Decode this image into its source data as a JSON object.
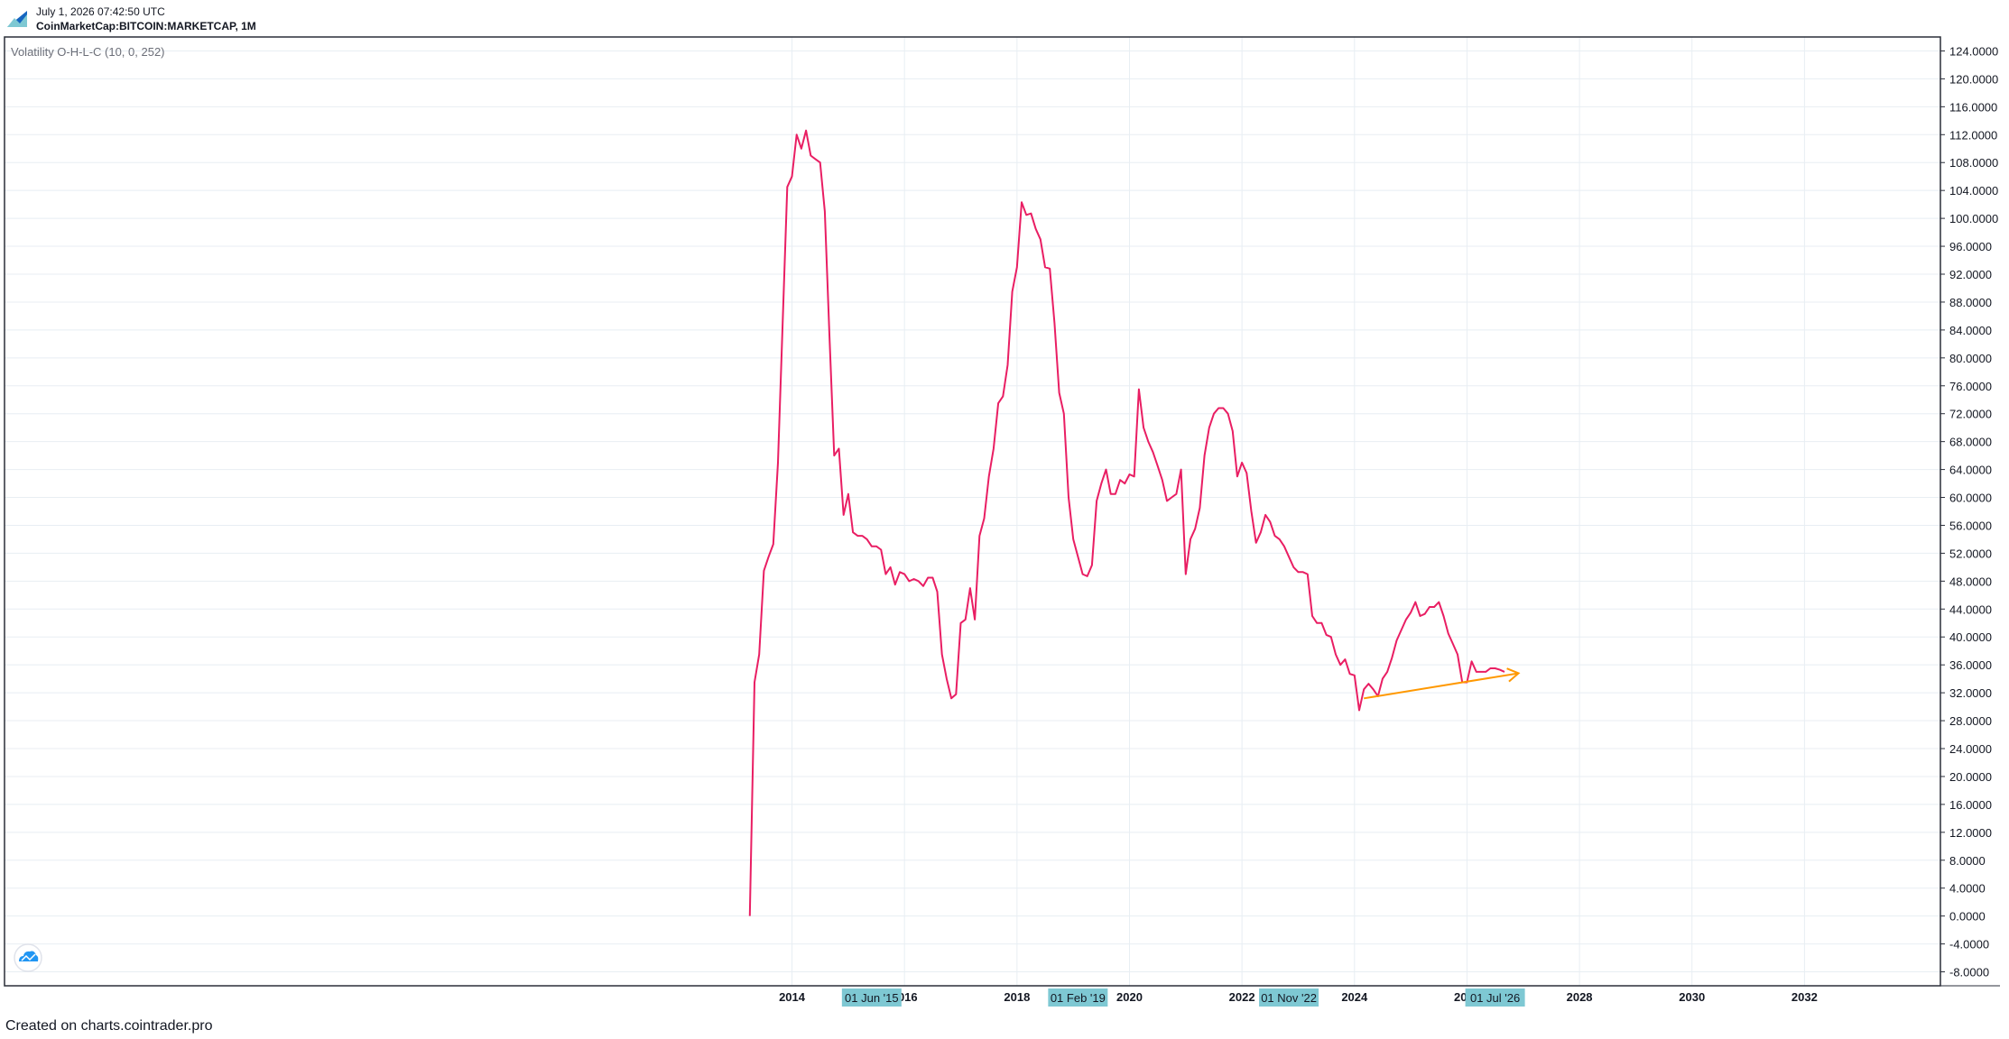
{
  "header": {
    "timestamp": "July 1, 2026 07:42:50 UTC",
    "symbol": "CoinMarketCap:BITCOIN:MARKETCAP, 1M"
  },
  "indicator_label": "Volatility O-H-L-C (10, 0, 252)",
  "footer": "Created on charts.cointrader.pro",
  "icons": {
    "logo": "cointrader-logo-icon",
    "watermark": "cointrader-cloud-icon"
  },
  "colors": {
    "series": "#e91e63",
    "trendline": "#ff9800",
    "marker_bg": "#7ec8d3",
    "grid": "#e8eef3"
  },
  "chart_data": {
    "type": "line",
    "title": "",
    "xlabel": "",
    "ylabel": "",
    "ylim": [
      -10,
      126
    ],
    "y_ticks": [
      "124.0000",
      "120.0000",
      "116.0000",
      "112.0000",
      "108.0000",
      "104.0000",
      "100.0000",
      "96.0000",
      "92.0000",
      "88.0000",
      "84.0000",
      "80.0000",
      "76.0000",
      "72.0000",
      "68.0000",
      "64.0000",
      "60.0000",
      "56.0000",
      "52.0000",
      "48.0000",
      "44.0000",
      "40.0000",
      "36.0000",
      "32.0000",
      "28.0000",
      "24.0000",
      "20.0000",
      "16.0000",
      "12.0000",
      "8.0000",
      "4.0000",
      "0.0000",
      "-4.0000",
      "-8.0000"
    ],
    "xlim": [
      "2000-01",
      "2034-06"
    ],
    "x_ticks": [
      "2014",
      "2016",
      "2018",
      "2020",
      "2022",
      "2024",
      "2026",
      "2028",
      "2030",
      "2032"
    ],
    "x_markers": [
      {
        "label": "01 Jun '15",
        "date": "2015-06"
      },
      {
        "label": "01 Feb '19",
        "date": "2019-02"
      },
      {
        "label": "01 Nov '22",
        "date": "2022-11"
      },
      {
        "label": "01 Jul '26",
        "date": "2026-07"
      }
    ],
    "grid": true,
    "series": [
      {
        "color": "#e91e63",
        "points": [
          [
            "2013-04",
            0
          ],
          [
            "2013-05",
            33.5
          ],
          [
            "2013-06",
            37.5
          ],
          [
            "2013-07",
            49.5
          ],
          [
            "2013-08",
            51.5
          ],
          [
            "2013-09",
            53.3
          ],
          [
            "2013-10",
            65
          ],
          [
            "2013-11",
            85
          ],
          [
            "2013-12",
            104.5
          ],
          [
            "2014-01",
            106
          ],
          [
            "2014-02",
            112
          ],
          [
            "2014-03",
            110
          ],
          [
            "2014-04",
            112.6
          ],
          [
            "2014-05",
            109
          ],
          [
            "2014-06",
            108.5
          ],
          [
            "2014-07",
            108
          ],
          [
            "2014-08",
            101
          ],
          [
            "2014-09",
            83
          ],
          [
            "2014-10",
            66
          ],
          [
            "2014-11",
            67
          ],
          [
            "2014-12",
            57.5
          ],
          [
            "2015-01",
            60.5
          ],
          [
            "2015-02",
            55
          ],
          [
            "2015-03",
            54.5
          ],
          [
            "2015-04",
            54.5
          ],
          [
            "2015-05",
            54
          ],
          [
            "2015-06",
            53
          ],
          [
            "2015-07",
            53
          ],
          [
            "2015-08",
            52.5
          ],
          [
            "2015-09",
            49
          ],
          [
            "2015-10",
            50
          ],
          [
            "2015-11",
            47.5
          ],
          [
            "2015-12",
            49.3
          ],
          [
            "2016-01",
            49
          ],
          [
            "2016-02",
            48
          ],
          [
            "2016-03",
            48.3
          ],
          [
            "2016-04",
            48
          ],
          [
            "2016-05",
            47.3
          ],
          [
            "2016-06",
            48.5
          ],
          [
            "2016-07",
            48.5
          ],
          [
            "2016-08",
            46.5
          ],
          [
            "2016-09",
            37.5
          ],
          [
            "2016-10",
            34
          ],
          [
            "2016-11",
            31.2
          ],
          [
            "2016-12",
            31.8
          ],
          [
            "2017-01",
            42
          ],
          [
            "2017-02",
            42.5
          ],
          [
            "2017-03",
            47
          ],
          [
            "2017-04",
            42.5
          ],
          [
            "2017-05",
            54.5
          ],
          [
            "2017-06",
            57
          ],
          [
            "2017-07",
            63
          ],
          [
            "2017-08",
            67
          ],
          [
            "2017-09",
            73.5
          ],
          [
            "2017-10",
            74.5
          ],
          [
            "2017-11",
            79
          ],
          [
            "2017-12",
            89.5
          ],
          [
            "2018-01",
            93
          ],
          [
            "2018-02",
            102.3
          ],
          [
            "2018-03",
            100.5
          ],
          [
            "2018-04",
            100.7
          ],
          [
            "2018-05",
            98.5
          ],
          [
            "2018-06",
            97
          ],
          [
            "2018-07",
            93
          ],
          [
            "2018-08",
            92.8
          ],
          [
            "2018-09",
            85
          ],
          [
            "2018-10",
            75
          ],
          [
            "2018-11",
            72
          ],
          [
            "2018-12",
            60
          ],
          [
            "2019-01",
            54
          ],
          [
            "2019-02",
            51.5
          ],
          [
            "2019-03",
            49
          ],
          [
            "2019-04",
            48.7
          ],
          [
            "2019-05",
            50.3
          ],
          [
            "2019-06",
            59.5
          ],
          [
            "2019-07",
            62
          ],
          [
            "2019-08",
            64
          ],
          [
            "2019-09",
            60.5
          ],
          [
            "2019-10",
            60.5
          ],
          [
            "2019-11",
            62.5
          ],
          [
            "2019-12",
            62
          ],
          [
            "2020-01",
            63.3
          ],
          [
            "2020-02",
            63
          ],
          [
            "2020-03",
            75.5
          ],
          [
            "2020-04",
            70
          ],
          [
            "2020-05",
            68
          ],
          [
            "2020-06",
            66.5
          ],
          [
            "2020-07",
            64.5
          ],
          [
            "2020-08",
            62.5
          ],
          [
            "2020-09",
            59.5
          ],
          [
            "2020-10",
            60
          ],
          [
            "2020-11",
            60.5
          ],
          [
            "2020-12",
            64
          ],
          [
            "2021-01",
            49
          ],
          [
            "2021-02",
            54
          ],
          [
            "2021-03",
            55.5
          ],
          [
            "2021-04",
            58.5
          ],
          [
            "2021-05",
            66
          ],
          [
            "2021-06",
            70
          ],
          [
            "2021-07",
            72
          ],
          [
            "2021-08",
            72.8
          ],
          [
            "2021-09",
            72.8
          ],
          [
            "2021-10",
            72
          ],
          [
            "2021-11",
            69.5
          ],
          [
            "2021-12",
            63
          ],
          [
            "2022-01",
            65
          ],
          [
            "2022-02",
            63.5
          ],
          [
            "2022-03",
            58
          ],
          [
            "2022-04",
            53.5
          ],
          [
            "2022-05",
            55
          ],
          [
            "2022-06",
            57.5
          ],
          [
            "2022-07",
            56.5
          ],
          [
            "2022-08",
            54.5
          ],
          [
            "2022-09",
            54
          ],
          [
            "2022-10",
            53
          ],
          [
            "2022-11",
            51.5
          ],
          [
            "2022-12",
            50
          ],
          [
            "2023-01",
            49.3
          ],
          [
            "2023-02",
            49.3
          ],
          [
            "2023-03",
            49
          ],
          [
            "2023-04",
            43
          ],
          [
            "2023-05",
            42
          ],
          [
            "2023-06",
            42
          ],
          [
            "2023-07",
            40.3
          ],
          [
            "2023-08",
            40
          ],
          [
            "2023-09",
            37.5
          ],
          [
            "2023-10",
            36
          ],
          [
            "2023-11",
            36.8
          ],
          [
            "2023-12",
            34.7
          ],
          [
            "2024-01",
            34.5
          ],
          [
            "2024-02",
            29.5
          ],
          [
            "2024-03",
            32.5
          ],
          [
            "2024-04",
            33.3
          ],
          [
            "2024-05",
            32.5
          ],
          [
            "2024-06",
            31.5
          ],
          [
            "2024-07",
            34
          ],
          [
            "2024-08",
            35
          ],
          [
            "2024-09",
            37
          ],
          [
            "2024-10",
            39.5
          ],
          [
            "2024-11",
            41
          ],
          [
            "2024-12",
            42.5
          ],
          [
            "2025-01",
            43.5
          ],
          [
            "2025-02",
            45
          ],
          [
            "2025-03",
            43
          ],
          [
            "2025-04",
            43.3
          ],
          [
            "2025-05",
            44.3
          ],
          [
            "2025-06",
            44.3
          ],
          [
            "2025-07",
            45
          ],
          [
            "2025-08",
            43
          ],
          [
            "2025-09",
            40.5
          ],
          [
            "2025-10",
            39
          ],
          [
            "2025-11",
            37.5
          ],
          [
            "2025-12",
            33.5
          ],
          [
            "2026-01",
            33.5
          ],
          [
            "2026-02",
            36.5
          ],
          [
            "2026-03",
            35
          ],
          [
            "2026-04",
            35
          ],
          [
            "2026-05",
            35
          ],
          [
            "2026-06",
            35.5
          ],
          [
            "2026-07",
            35.5
          ],
          [
            "2026-08",
            35.3
          ],
          [
            "2026-09",
            35
          ]
        ]
      }
    ],
    "trendline": {
      "color": "#ff9800",
      "start": [
        "2024-03",
        31.2
      ],
      "end": [
        "2026-12",
        34.8
      ],
      "arrow": true
    }
  }
}
